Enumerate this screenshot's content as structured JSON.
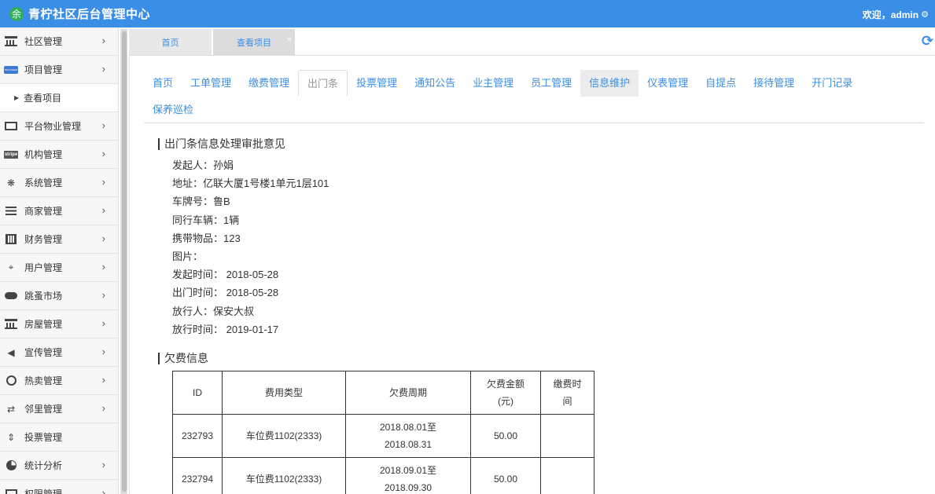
{
  "header": {
    "app_title": "青柠社区后台管理中心",
    "logo_glyph": "余",
    "welcome": "欢迎，admin",
    "gear_icon": "gear-icon"
  },
  "sidebar": {
    "items": [
      {
        "label": "社区管理",
        "icon": "bank-icon"
      },
      {
        "label": "项目管理",
        "icon": "card-icon",
        "expanded": true
      },
      {
        "label": "平台物业管理",
        "icon": "monitor-icon"
      },
      {
        "label": "机构管理",
        "icon": "stripe-icon"
      },
      {
        "label": "系统管理",
        "icon": "cluster-icon"
      },
      {
        "label": "商家管理",
        "icon": "list-icon"
      },
      {
        "label": "财务管理",
        "icon": "calculator-icon"
      },
      {
        "label": "用户管理",
        "icon": "crop-icon"
      },
      {
        "label": "跳蚤市场",
        "icon": "cloud-icon"
      },
      {
        "label": "房屋管理",
        "icon": "bank-icon"
      },
      {
        "label": "宣传管理",
        "icon": "speaker-icon"
      },
      {
        "label": "热卖管理",
        "icon": "sun-icon"
      },
      {
        "label": "邻里管理",
        "icon": "retweet-icon"
      },
      {
        "label": "投票管理",
        "icon": "sort-icon"
      },
      {
        "label": "统计分析",
        "icon": "pie-chart-icon"
      },
      {
        "label": "权限管理",
        "icon": "box-icon"
      }
    ],
    "sub_item": "查看项目",
    "stripe_text": "stripe",
    "card_text": "PAYONEER"
  },
  "tabs": [
    {
      "label": "首页"
    },
    {
      "label": "查看项目"
    }
  ],
  "nav": {
    "row1": [
      "首页",
      "工单管理",
      "缴费管理",
      "出门条",
      "投票管理",
      "通知公告",
      "业主管理",
      "员工管理",
      "信息维护",
      "仪表管理",
      "自提点",
      "接待管理",
      "开门记录"
    ],
    "row2": [
      "保养巡检"
    ]
  },
  "section1": {
    "title": "出门条信息处理审批意见",
    "rows": [
      "发起人：孙娟",
      "地址：亿联大厦1号楼1单元1层101",
      "车牌号：鲁B",
      "同行车辆：1辆",
      "携带物品：123",
      "图片：",
      "发起时间： 2018-05-28",
      "出门时间： 2018-05-28",
      "放行人：保安大叔",
      "放行时间： 2019-01-17"
    ]
  },
  "section2": {
    "title": "欠费信息",
    "headers": [
      "ID",
      "费用类型",
      "欠费周期",
      "欠费金额\n(元)",
      "缴费时\n间"
    ],
    "rows": [
      {
        "id": "232793",
        "type": "车位费1102(2333)",
        "period_a": "2018.08.01至",
        "period_b": "2018.08.31",
        "amount": "50.00",
        "paid": ""
      },
      {
        "id": "232794",
        "type": "车位费1102(2333)",
        "period_a": "2018.09.01至",
        "period_b": "2018.09.30",
        "amount": "50.00",
        "paid": ""
      }
    ]
  },
  "colors": {
    "accent": "#3a8ee6",
    "logo": "#2fae5a"
  }
}
